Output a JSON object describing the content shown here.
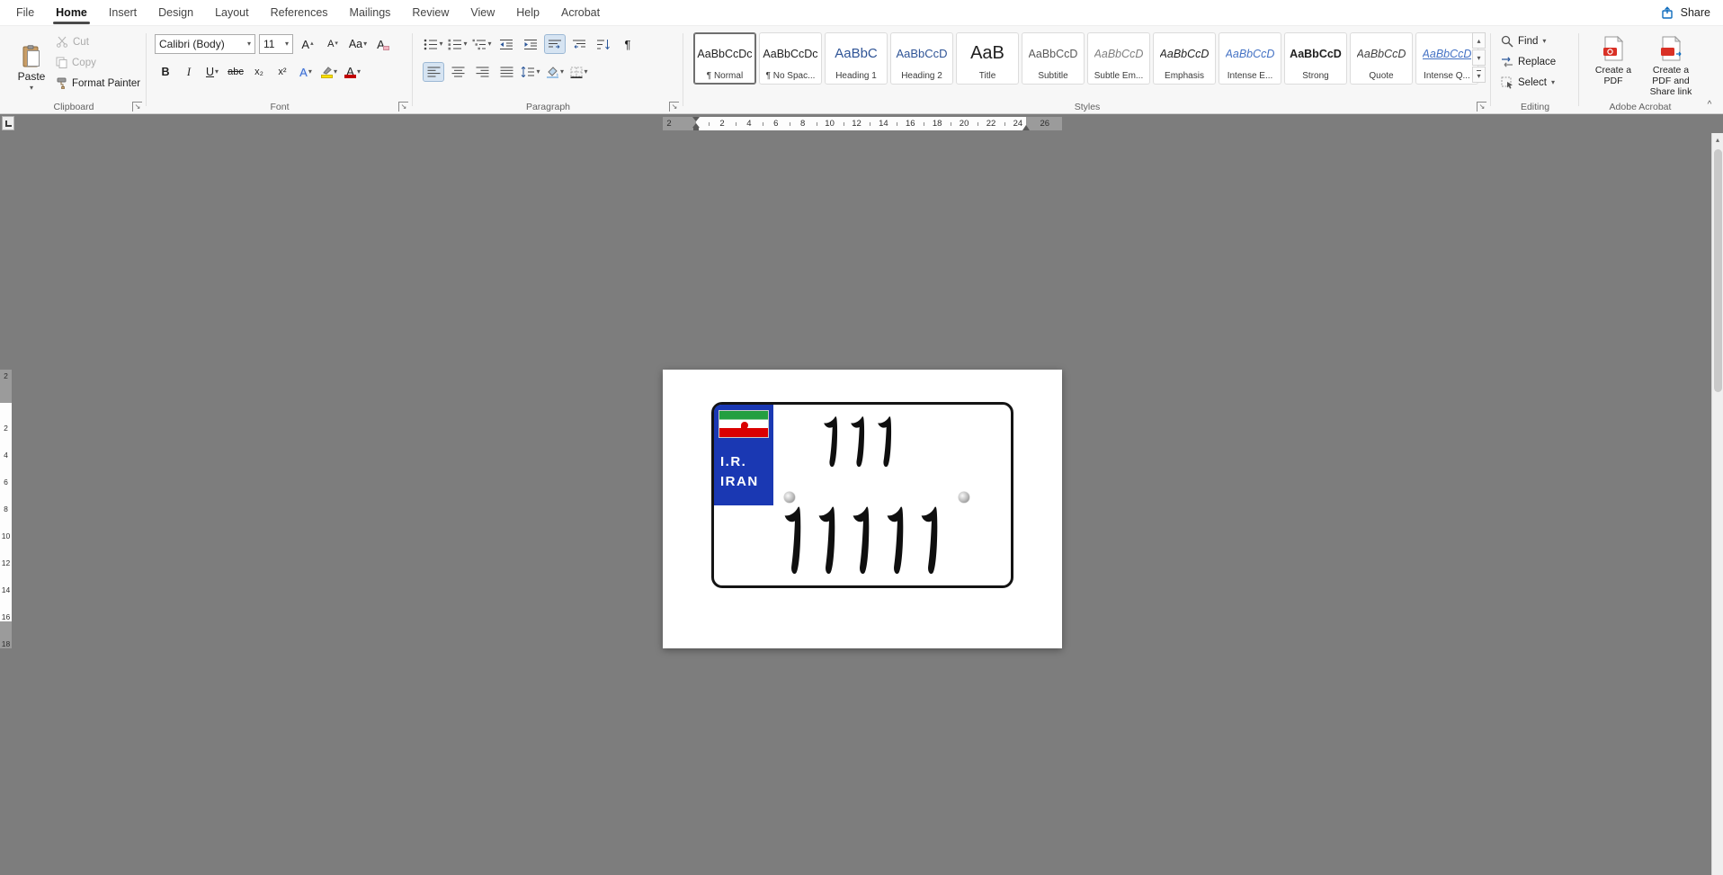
{
  "menu": {
    "tabs": [
      "File",
      "Home",
      "Insert",
      "Design",
      "Layout",
      "References",
      "Mailings",
      "Review",
      "View",
      "Help",
      "Acrobat"
    ],
    "active": "Home",
    "share_label": "Share"
  },
  "icons": {
    "chevron_down": "▾",
    "up": "▴",
    "down": "▾",
    "pilcrow": "¶",
    "launcher_arrow": "↘",
    "collapse": "^",
    "grow_arrow": "▴",
    "shrink_arrow": "▾"
  },
  "ribbon": {
    "clipboard": {
      "group_label": "Clipboard",
      "paste": "Paste",
      "cut": "Cut",
      "copy": "Copy",
      "format_painter": "Format Painter"
    },
    "font": {
      "group_label": "Font",
      "family": "Calibri (Body)",
      "size": "11",
      "bold": "B",
      "italic": "I",
      "underline": "U",
      "strike": "abc",
      "subscript": "x₂",
      "superscript": "x²",
      "effects": "A",
      "case_label": "Aa",
      "grow": "A",
      "shrink": "A",
      "clear": "A",
      "color": "A"
    },
    "paragraph": {
      "group_label": "Paragraph"
    },
    "styles": {
      "group_label": "Styles",
      "items": [
        {
          "preview": "AaBbCcDc",
          "label": "¶ Normal",
          "cls": "normal",
          "selected": true
        },
        {
          "preview": "AaBbCcDc",
          "label": "¶ No Spac...",
          "cls": "nospace",
          "selected": false
        },
        {
          "preview": "AaBbC",
          "label": "Heading 1",
          "cls": "h1",
          "selected": false
        },
        {
          "preview": "AaBbCcD",
          "label": "Heading 2",
          "cls": "h2",
          "selected": false
        },
        {
          "preview": "AaB",
          "label": "Title",
          "cls": "title",
          "selected": false
        },
        {
          "preview": "AaBbCcD",
          "label": "Subtitle",
          "cls": "subtitle",
          "selected": false
        },
        {
          "preview": "AaBbCcD",
          "label": "Subtle Em...",
          "cls": "subtleem",
          "selected": false
        },
        {
          "preview": "AaBbCcD",
          "label": "Emphasis",
          "cls": "emphasis",
          "selected": false
        },
        {
          "preview": "AaBbCcD",
          "label": "Intense E...",
          "cls": "intenseem",
          "selected": false
        },
        {
          "preview": "AaBbCcD",
          "label": "Strong",
          "cls": "strong",
          "selected": false
        },
        {
          "preview": "AaBbCcD",
          "label": "Quote",
          "cls": "quote",
          "selected": false
        },
        {
          "preview": "AaBbCcD",
          "label": "Intense Q...",
          "cls": "intenseq",
          "selected": false
        }
      ]
    },
    "editing": {
      "group_label": "Editing",
      "items": [
        {
          "label": "Find",
          "icon": "find",
          "dropdown": true
        },
        {
          "label": "Replace",
          "icon": "replace",
          "dropdown": false
        },
        {
          "label": "Select",
          "icon": "select",
          "dropdown": true
        }
      ]
    },
    "acrobat": {
      "group_label": "Adobe Acrobat",
      "buttons": [
        {
          "label": "Create a PDF"
        },
        {
          "label": "Create a PDF and Share link"
        }
      ]
    }
  },
  "ruler": {
    "h_margin_label": "2",
    "h_labels": [
      "2",
      "4",
      "6",
      "8",
      "10",
      "12",
      "14",
      "16",
      "18",
      "20",
      "22",
      "24",
      "26"
    ],
    "v_margin_label": "2",
    "v_labels": [
      "2",
      "4",
      "6",
      "8",
      "10",
      "12",
      "14",
      "16",
      "18"
    ]
  },
  "document": {
    "plate": {
      "region_line1": "I.R.",
      "region_line2": "IRAN",
      "top_digits": "۱۱۱",
      "bottom_digits": "۱۱۱۱۱",
      "top_count": 3,
      "bottom_count": 5
    }
  },
  "colors": {
    "accent_blue": "#2b579a",
    "heading_blue": "#2f5496",
    "intense_blue": "#4472c4",
    "plate_band_blue": "#1a38b3",
    "flag_green": "#239f40",
    "flag_red": "#da0000",
    "highlight_yellow": "#ffe000",
    "font_color_red": "#c00000",
    "canvas_gray": "#7d7d7d"
  }
}
